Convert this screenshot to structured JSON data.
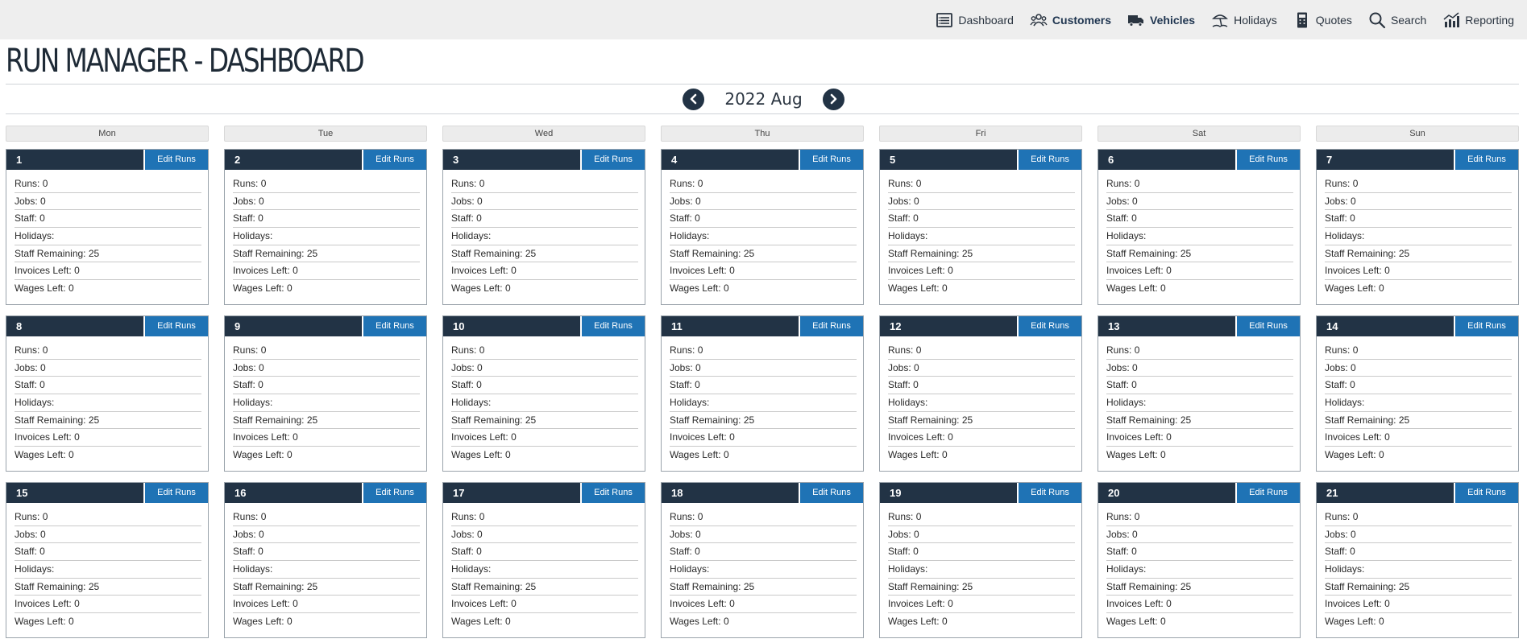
{
  "nav": {
    "items": [
      {
        "label": "Dashboard",
        "icon": "table-list-icon",
        "bold": false
      },
      {
        "label": "Customers",
        "icon": "users-icon",
        "bold": true
      },
      {
        "label": "Vehicles",
        "icon": "truck-icon",
        "bold": true
      },
      {
        "label": "Holidays",
        "icon": "beach-umbrella-icon",
        "bold": false
      },
      {
        "label": "Quotes",
        "icon": "document-calculator-icon",
        "bold": false
      },
      {
        "label": "Search",
        "icon": "search-icon",
        "bold": false
      },
      {
        "label": "Reporting",
        "icon": "bar-chart-icon",
        "bold": false
      }
    ]
  },
  "page": {
    "title": "RUN MANAGER - DASHBOARD",
    "month_label": "2022 Aug"
  },
  "calendar": {
    "weekdays": [
      "Mon",
      "Tue",
      "Wed",
      "Thu",
      "Fri",
      "Sat",
      "Sun"
    ],
    "edit_label": "Edit Runs",
    "stat_labels": [
      "Runs:",
      "Jobs:",
      "Staff:",
      "Holidays:",
      "Staff Remaining:",
      "Invoices Left:",
      "Wages Left:"
    ],
    "weeks": [
      [
        {
          "day": "1",
          "stats": [
            "0",
            "0",
            "0",
            "",
            "25",
            "0",
            "0"
          ]
        },
        {
          "day": "2",
          "stats": [
            "0",
            "0",
            "0",
            "",
            "25",
            "0",
            "0"
          ]
        },
        {
          "day": "3",
          "stats": [
            "0",
            "0",
            "0",
            "",
            "25",
            "0",
            "0"
          ]
        },
        {
          "day": "4",
          "stats": [
            "0",
            "0",
            "0",
            "",
            "25",
            "0",
            "0"
          ]
        },
        {
          "day": "5",
          "stats": [
            "0",
            "0",
            "0",
            "",
            "25",
            "0",
            "0"
          ]
        },
        {
          "day": "6",
          "stats": [
            "0",
            "0",
            "0",
            "",
            "25",
            "0",
            "0"
          ]
        },
        {
          "day": "7",
          "stats": [
            "0",
            "0",
            "0",
            "",
            "25",
            "0",
            "0"
          ]
        }
      ],
      [
        {
          "day": "8",
          "stats": [
            "0",
            "0",
            "0",
            "",
            "25",
            "0",
            "0"
          ]
        },
        {
          "day": "9",
          "stats": [
            "0",
            "0",
            "0",
            "",
            "25",
            "0",
            "0"
          ]
        },
        {
          "day": "10",
          "stats": [
            "0",
            "0",
            "0",
            "",
            "25",
            "0",
            "0"
          ]
        },
        {
          "day": "11",
          "stats": [
            "0",
            "0",
            "0",
            "",
            "25",
            "0",
            "0"
          ]
        },
        {
          "day": "12",
          "stats": [
            "0",
            "0",
            "0",
            "",
            "25",
            "0",
            "0"
          ]
        },
        {
          "day": "13",
          "stats": [
            "0",
            "0",
            "0",
            "",
            "25",
            "0",
            "0"
          ]
        },
        {
          "day": "14",
          "stats": [
            "0",
            "0",
            "0",
            "",
            "25",
            "0",
            "0"
          ]
        }
      ],
      [
        {
          "day": "15",
          "stats": [
            "0",
            "0",
            "0",
            "",
            "25",
            "0",
            "0"
          ]
        },
        {
          "day": "16",
          "stats": [
            "0",
            "0",
            "0",
            "",
            "25",
            "0",
            "0"
          ]
        },
        {
          "day": "17",
          "stats": [
            "0",
            "0",
            "0",
            "",
            "25",
            "0",
            "0"
          ]
        },
        {
          "day": "18",
          "stats": [
            "0",
            "0",
            "0",
            "",
            "25",
            "0",
            "0"
          ]
        },
        {
          "day": "19",
          "stats": [
            "0",
            "0",
            "0",
            "",
            "25",
            "0",
            "0"
          ]
        },
        {
          "day": "20",
          "stats": [
            "0",
            "0",
            "0",
            "",
            "25",
            "0",
            "0"
          ]
        },
        {
          "day": "21",
          "stats": [
            "0",
            "0",
            "0",
            "",
            "25",
            "0",
            "0"
          ]
        }
      ]
    ]
  },
  "colors": {
    "topbar": "#eeeeee",
    "day_header": "#223345",
    "edit_button": "#1f73b5",
    "nav_button": "#223345"
  }
}
